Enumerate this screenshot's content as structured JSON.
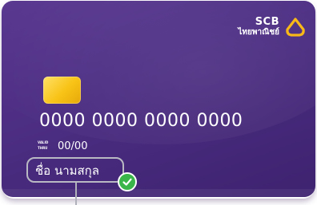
{
  "card": {
    "brand_name": "SCB",
    "brand_name_thai": "ไทยพาณิชย์",
    "card_number": "0000 0000 0000 0000",
    "valid_thru_label_line1": "VALID",
    "valid_thru_label_line2": "THRU",
    "expiry": "00/00",
    "holder_name": "ชื่อ นามสกุล",
    "logo_icon": "scb-lotus-icon",
    "check_icon": "checkmark-icon"
  },
  "colors": {
    "card_purple": "#4e2f85",
    "logo_gold": "#f7b818",
    "chip_gold": "#f8c316",
    "check_green": "#39b54a",
    "callout_gray": "#b9b9c4"
  }
}
